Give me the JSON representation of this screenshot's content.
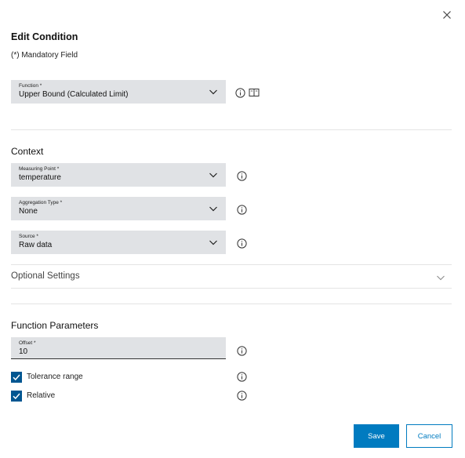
{
  "dialog": {
    "title": "Edit Condition",
    "mandatory_note": "(*) Mandatory Field"
  },
  "function_field": {
    "label": "Function *",
    "value": "Upper Bound (Calculated Limit)"
  },
  "context": {
    "heading": "Context",
    "fields": [
      {
        "label": "Measuring Point *",
        "value": "temperature"
      },
      {
        "label": "Aggregation Type *",
        "value": "None"
      },
      {
        "label": "Source *",
        "value": "Raw data"
      }
    ]
  },
  "optional_settings": {
    "label": "Optional Settings",
    "expanded": false
  },
  "function_parameters": {
    "heading": "Function Parameters",
    "offset": {
      "label": "Offset *",
      "value": "10"
    },
    "checkboxes": [
      {
        "label": "Tolerance range",
        "checked": true
      },
      {
        "label": "Relative",
        "checked": true
      }
    ]
  },
  "actions": {
    "save_label": "Save",
    "cancel_label": "Cancel"
  },
  "colors": {
    "primary": "#007bc0",
    "checkbox": "#005691",
    "field_bg": "#e0e2e5"
  },
  "icons": [
    "close-icon",
    "chevron-down-icon",
    "info-icon",
    "book-icon",
    "checkmark-icon"
  ]
}
